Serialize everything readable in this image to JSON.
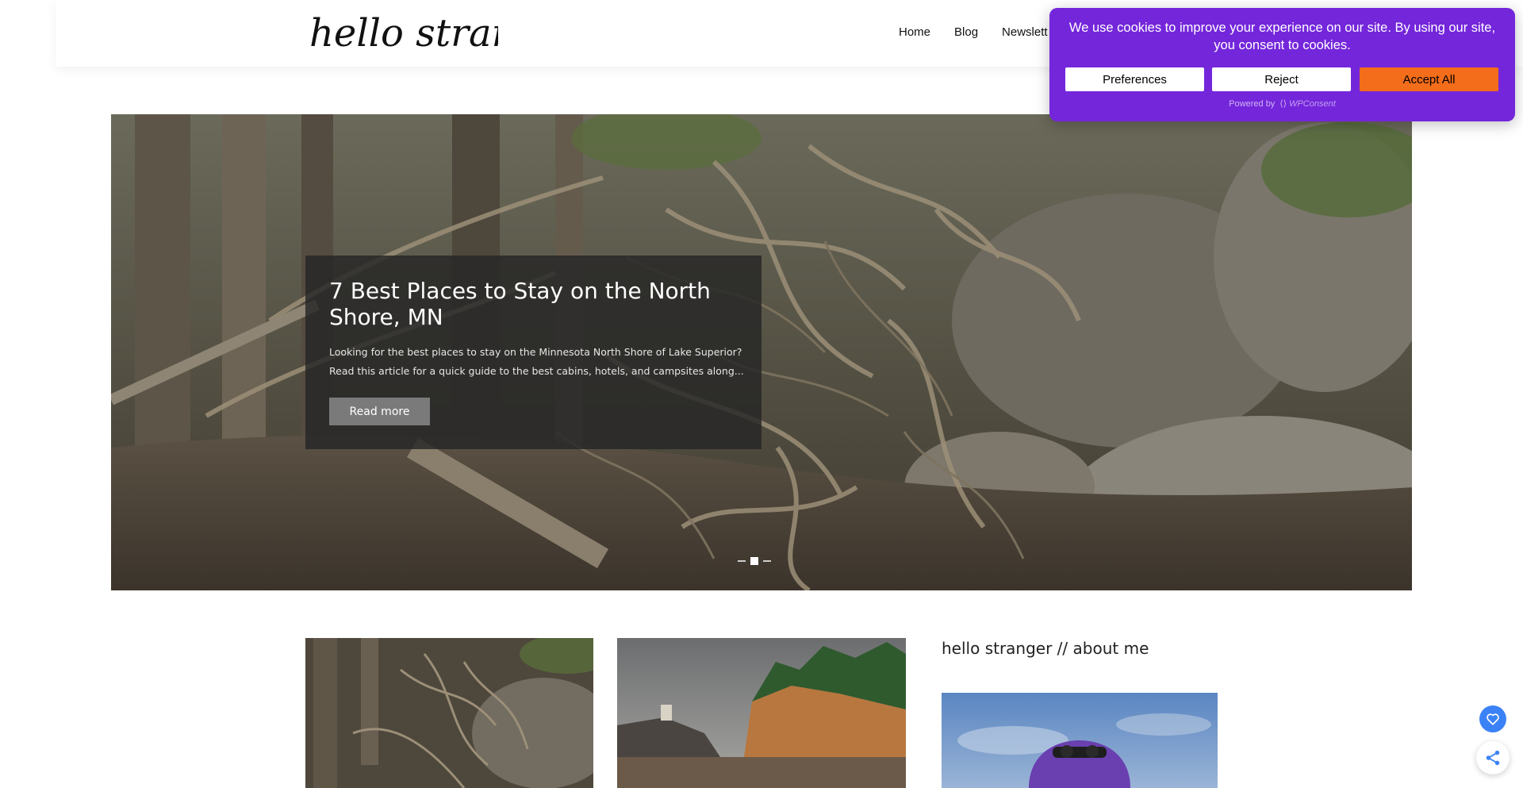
{
  "site": {
    "logo_text": "hello stranger"
  },
  "nav": {
    "items": [
      "Home",
      "Blog",
      "Newslett"
    ]
  },
  "hero": {
    "title": "7 Best Places to Stay on the North Shore, MN",
    "excerpt": "Looking for the best places to stay on the Minnesota North Shore of Lake Superior? Read this article for a quick guide to the best cabins, hotels, and campsites along...",
    "button_label": "Read more",
    "slides_total": 3,
    "active_slide": 2
  },
  "sidebar": {
    "about_title": "hello stranger // about me"
  },
  "cookie_banner": {
    "message": "We use cookies to improve your experience on our site. By using our site, you consent to cookies.",
    "preferences_label": "Preferences",
    "reject_label": "Reject",
    "accept_label": "Accept All",
    "powered_by_label": "Powered by",
    "powered_by_brand": "WPConsent",
    "background_color": "#7426db",
    "accept_color": "#f36d1a"
  },
  "floating": {
    "heart_icon": "heart-icon",
    "share_icon": "share-icon",
    "heart_color": "#3b82f6"
  }
}
